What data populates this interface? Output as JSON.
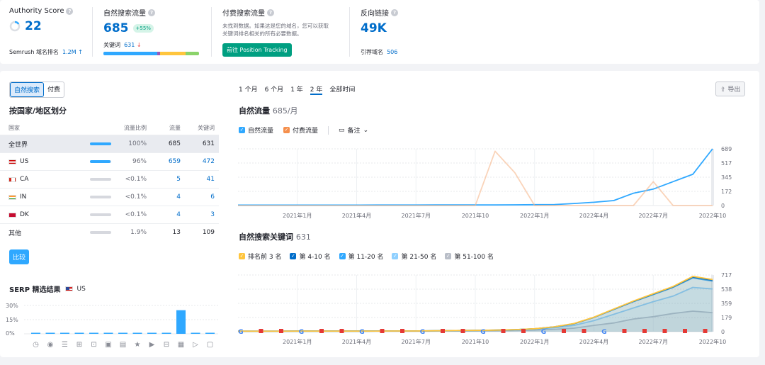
{
  "metrics": {
    "authority": {
      "label": "Authority Score",
      "value": "22",
      "rank_label": "Semrush 域名排名",
      "rank_value": "1.2M"
    },
    "organic": {
      "label": "自然搜索流量",
      "value": "685",
      "badge": "+55%",
      "kw_label": "关键词",
      "kw_value": "631"
    },
    "paid": {
      "label": "付费搜索流量",
      "desc_line1": "未找到数据。如果这是您的域名，您可以获取",
      "desc_line2": "关键词排名相关的所有必要数据。",
      "button": "前往 Position Tracking"
    },
    "backlinks": {
      "label": "反向链接",
      "value": "49K",
      "ref_label": "引荐域名",
      "ref_value": "506"
    }
  },
  "segment": {
    "organic": "自然搜索",
    "paid": "付费"
  },
  "country": {
    "title": "按国家/地区划分",
    "headers": {
      "country": "国家",
      "share": "流量比例",
      "traffic": "流量",
      "keywords": "关键词"
    },
    "rows": [
      {
        "name": "全世界",
        "share": "100%",
        "share_val": 1.0,
        "traffic": "685",
        "keywords": "631"
      },
      {
        "name": "US",
        "share": "96%",
        "share_val": 0.96,
        "traffic": "659",
        "keywords": "472"
      },
      {
        "name": "CA",
        "share": "<0.1%",
        "share_val": 0.0,
        "traffic": "5",
        "keywords": "41"
      },
      {
        "name": "IN",
        "share": "<0.1%",
        "share_val": 0.0,
        "traffic": "4",
        "keywords": "6"
      },
      {
        "name": "DK",
        "share": "<0.1%",
        "share_val": 0.0,
        "traffic": "4",
        "keywords": "3"
      },
      {
        "name": "其他",
        "share": "1.9%",
        "share_val": 0.0,
        "traffic": "13",
        "keywords": "109"
      }
    ],
    "compare_button": "比较"
  },
  "serp": {
    "title": "SERP 精选结果",
    "country": "US",
    "y_ticks": [
      "30%",
      "15%",
      "0%"
    ],
    "icons": [
      "featured-snippet-icon",
      "local-pack-icon",
      "reviews-icon",
      "sitelinks-icon",
      "video-icon",
      "image-pack-icon",
      "top-stories-icon",
      "star-icon",
      "play-icon",
      "shopping-icon",
      "image-icon",
      "carousel-icon",
      "faq-icon",
      "question-icon"
    ]
  },
  "timeframes": [
    "1 个月",
    "6 个月",
    "1 年",
    "2 年",
    "全部时间"
  ],
  "timeframe_active": "2 年",
  "export_label": "导出",
  "traffic_chart": {
    "title": "自然流量",
    "subtitle": "685/月",
    "legend_organic": "自然流量",
    "legend_paid": "付费流量",
    "notes": "备注"
  },
  "kw_chart": {
    "title": "自然搜索关键词",
    "subtitle": "631",
    "legend": [
      "排名前 3 名",
      "第 4-10 名",
      "第 11-20 名",
      "第 21-50 名",
      "第 51-100 名"
    ]
  },
  "chart_data": [
    {
      "type": "line",
      "x": [
        "2020-10",
        "2020-11",
        "2020-12",
        "2021-01",
        "2021-02",
        "2021-03",
        "2021-04",
        "2021-05",
        "2021-06",
        "2021-07",
        "2021-08",
        "2021-09",
        "2021-10",
        "2021-11",
        "2021-12",
        "2022-01",
        "2022-02",
        "2022-03",
        "2022-04",
        "2022-05",
        "2022-06",
        "2022-07",
        "2022-08",
        "2022-09",
        "2022-10"
      ],
      "x_tick_labels": [
        "2021年1月",
        "2021年4月",
        "2021年7月",
        "2021年10",
        "2022年1月",
        "2022年4月",
        "2022年7月",
        "2022年10"
      ],
      "y_ticks": [
        "689",
        "517",
        "345",
        "172",
        "0"
      ],
      "ylim": [
        0,
        689
      ],
      "series": [
        {
          "name": "自然流量",
          "color": "#2fa8ff",
          "values": [
            5,
            5,
            5,
            5,
            5,
            5,
            5,
            6,
            6,
            6,
            7,
            7,
            8,
            8,
            9,
            10,
            12,
            25,
            40,
            60,
            150,
            200,
            290,
            380,
            689
          ]
        },
        {
          "name": "付费流量",
          "color": "#f7b88c",
          "values": [
            0,
            0,
            0,
            0,
            0,
            0,
            0,
            0,
            0,
            0,
            0,
            0,
            0,
            660,
            400,
            0,
            0,
            0,
            0,
            0,
            0,
            290,
            0,
            0,
            0
          ]
        }
      ]
    },
    {
      "type": "area",
      "x": [
        "2020-10",
        "2020-11",
        "2020-12",
        "2021-01",
        "2021-02",
        "2021-03",
        "2021-04",
        "2021-05",
        "2021-06",
        "2021-07",
        "2021-08",
        "2021-09",
        "2021-10",
        "2021-11",
        "2021-12",
        "2022-01",
        "2022-02",
        "2022-03",
        "2022-04",
        "2022-05",
        "2022-06",
        "2022-07",
        "2022-08",
        "2022-09",
        "2022-10"
      ],
      "x_tick_labels": [
        "2021年1月",
        "2021年4月",
        "2021年7月",
        "2021年10",
        "2022年1月",
        "2022年4月",
        "2022年7月",
        "2022年10"
      ],
      "y_ticks": [
        "717",
        "538",
        "359",
        "179",
        "0"
      ],
      "ylim": [
        0,
        717
      ],
      "series": [
        {
          "name": "第 51-100 名",
          "color": "#b9bec8",
          "values": [
            4,
            4,
            4,
            5,
            5,
            5,
            5,
            6,
            6,
            6,
            8,
            9,
            10,
            12,
            15,
            20,
            30,
            45,
            80,
            110,
            160,
            190,
            230,
            260,
            240
          ]
        },
        {
          "name": "第 21-50 名",
          "color": "#8fd0ff",
          "values": [
            5,
            5,
            5,
            6,
            6,
            6,
            6,
            7,
            8,
            8,
            10,
            12,
            14,
            18,
            22,
            30,
            50,
            80,
            140,
            220,
            300,
            380,
            450,
            560,
            540
          ]
        },
        {
          "name": "第 11-20 名",
          "color": "#2fa8ff",
          "values": [
            6,
            6,
            6,
            7,
            7,
            7,
            7,
            8,
            9,
            9,
            12,
            14,
            16,
            20,
            26,
            36,
            60,
            100,
            180,
            280,
            380,
            470,
            560,
            680,
            640
          ]
        },
        {
          "name": "第 4-10 名",
          "color": "#006dca",
          "values": [
            6,
            6,
            6,
            7,
            7,
            7,
            7,
            8,
            9,
            9,
            12,
            14,
            16,
            20,
            26,
            37,
            61,
            102,
            182,
            284,
            384,
            476,
            566,
            690,
            650
          ]
        },
        {
          "name": "排名前 3 名",
          "color": "#ffc53d",
          "values": [
            6,
            6,
            6,
            7,
            7,
            7,
            7,
            8,
            9,
            9,
            12,
            14,
            16,
            20,
            26,
            38,
            62,
            104,
            184,
            286,
            388,
            480,
            572,
            700,
            660
          ]
        }
      ]
    }
  ]
}
